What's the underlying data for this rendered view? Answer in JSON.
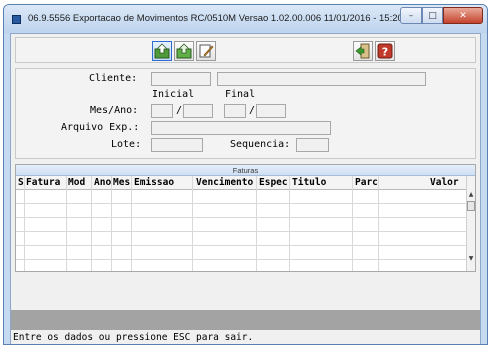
{
  "window": {
    "title": "06.9.5556  Exportacao  de Movimentos RC/0510M Versao 1.02.00.006 11/01/2016 - 15:20",
    "minimize_glyph": "–",
    "maximize_glyph": "□",
    "close_glyph": "✕"
  },
  "toolbar": {
    "icons": [
      "export-selected-icon",
      "export-icon",
      "edit-icon",
      "exit-icon",
      "help-icon"
    ]
  },
  "form": {
    "cliente_label": "Cliente:",
    "inicial_label": "Inicial",
    "final_label": "Final",
    "mes_ano_label": "Mes/Ano:",
    "slash_inicial": "/",
    "slash_final": "/",
    "arquivo_label": "Arquivo Exp.:",
    "lote_label": "Lote:",
    "sequencia_label": "Sequencia:"
  },
  "grid": {
    "caption": "Faturas",
    "columns": [
      "S",
      "Fatura",
      "Mod",
      "Ano",
      "Mes",
      "Emissao",
      "Vencimento",
      "Espec",
      "Titulo",
      "Parc",
      "Valor"
    ],
    "scroll_up": "▲",
    "scroll_down": "▼"
  },
  "status": {
    "text": "Entre os dados ou pressione ESC para sair."
  }
}
